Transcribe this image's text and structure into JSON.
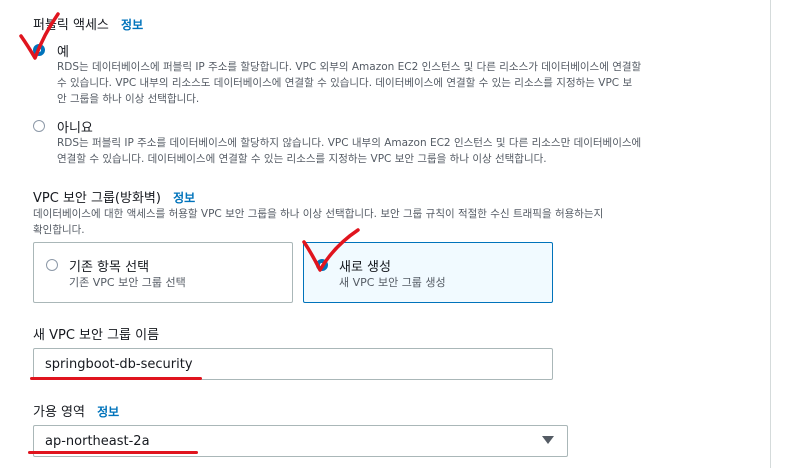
{
  "public_access": {
    "title": "퍼블릭 액세스",
    "info": "정보",
    "option_yes": {
      "label": "예",
      "desc1": "RDS는 데이터베이스에 퍼블릭 IP 주소를 할당합니다. VPC 외부의 Amazon EC2 인스턴스 및 다른 리소스가 데이터베이스에 연결할",
      "desc2": "수 있습니다. VPC 내부의 리소스도 데이터베이스에 연결할 수 있습니다. 데이터베이스에 연결할 수 있는 리소스를 지정하는 VPC 보",
      "desc3": "안 그룹을 하나 이상 선택합니다.",
      "selected": true
    },
    "option_no": {
      "label": "아니요",
      "desc1": "RDS는 퍼블릭 IP 주소를 데이터베이스에 할당하지 않습니다. VPC 내부의 Amazon EC2 인스턴스 및 다른 리소스만 데이터베이스에",
      "desc2": "연결할 수 있습니다. 데이터베이스에 연결할 수 있는 리소스를 지정하는 VPC 보안 그룹을 하나 이상 선택합니다.",
      "selected": false
    }
  },
  "vpc_security_group": {
    "title": "VPC 보안 그룹(방화벽)",
    "info": "정보",
    "desc1": "데이터베이스에 대한 액세스를 허용할 VPC 보안 그룹을 하나 이상 선택합니다. 보안 그룹 규칙이 적절한 수신 트래픽을 허용하는지",
    "desc2": "확인합니다.",
    "existing": {
      "title": "기존 항목 선택",
      "desc": "기존 VPC 보안 그룹 선택",
      "selected": false
    },
    "create_new": {
      "title": "새로 생성",
      "desc": "새 VPC 보안 그룹 생성",
      "selected": true
    }
  },
  "new_sg_name": {
    "label": "새 VPC 보안 그룹 이름",
    "value": "springboot-db-security"
  },
  "availability_zone": {
    "label": "가용 영역",
    "info": "정보",
    "value": "ap-northeast-2a"
  },
  "colors": {
    "accent": "#0073bb",
    "annotation_red": "#e0141e",
    "selected_card_bg": "#f1faff"
  }
}
